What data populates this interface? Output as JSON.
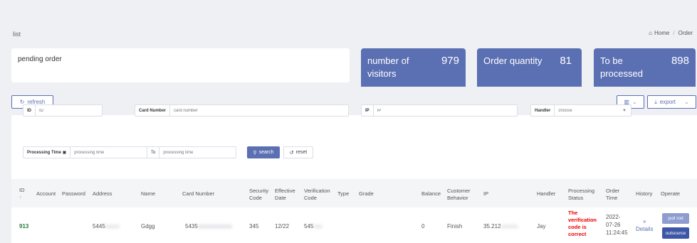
{
  "page": {
    "list_label": "list"
  },
  "breadcrumb": {
    "home": "Home",
    "separator": "/",
    "current": "Order"
  },
  "pending": {
    "label": "pending order"
  },
  "stats": [
    {
      "label_line1": "number of",
      "label_line2": "visitors",
      "value": "979"
    },
    {
      "label_line1": "Order quantity",
      "label_line2": "",
      "value": "81"
    },
    {
      "label_line1": "To be",
      "label_line2": "processed",
      "value": "898"
    }
  ],
  "toolbar": {
    "refresh_label": "refresh",
    "export_label": "export"
  },
  "filters": {
    "id": {
      "label": "ID",
      "placeholder": "ID"
    },
    "card": {
      "label": "Card Number",
      "placeholder": "card number"
    },
    "ip": {
      "label": "IP",
      "placeholder": "IP"
    },
    "handler": {
      "label": "Handler",
      "placeholder": "choose"
    },
    "time": {
      "label": "Processing Time",
      "start_placeholder": "processing time",
      "to": "To",
      "end_placeholder": "processing time"
    },
    "search_label": "search",
    "reset_label": "reset"
  },
  "table": {
    "columns": {
      "id": "ID",
      "account": "Account",
      "password": "Password",
      "address": "Address",
      "name": "Name",
      "card_number": "Card Number",
      "security_code_1": "Security",
      "security_code_2": "Code",
      "effective_date_1": "Effective",
      "effective_date_2": "Date",
      "verification_code_1": "Verification",
      "verification_code_2": "Code",
      "type": "Type",
      "grade": "Grade",
      "balance": "Balance",
      "customer_behavior_1": "Customer",
      "customer_behavior_2": "Behavior",
      "ip": "IP",
      "handler": "Handler",
      "processing_status_1": "Processing",
      "processing_status_2": "Status",
      "order_time_1": "Order",
      "order_time_2": "Time",
      "history": "History",
      "operate": "Operate"
    },
    "rows": [
      {
        "id": "913",
        "address": "5445",
        "address_hidden": "xxxxx",
        "name": "Gdgg",
        "card_number": "5435",
        "card_hidden": "xxxxxxxxxxxx",
        "security_code": "345",
        "effective_date": "12/22",
        "verification_code": "545",
        "verification_hidden": "xxx",
        "balance": "0",
        "customer_behavior": "Finish",
        "ip": "35.212",
        "ip_hidden": "xxxxxx",
        "handler": "Jay",
        "status_1": "The",
        "status_2": "verification",
        "status_3": "code is",
        "status_4": "correct",
        "order_time_1": "2022-",
        "order_time_2": "07-26",
        "order_time_3": "11:24:45",
        "history_arrow": "»",
        "history_label": "Details",
        "pull_rod_label": "pull rod",
        "outsource_label": "outsource"
      }
    ]
  },
  "colors": {
    "accent": "#5b6fb3",
    "status_error": "#ee0000",
    "id_green": "#2a7a3c"
  }
}
